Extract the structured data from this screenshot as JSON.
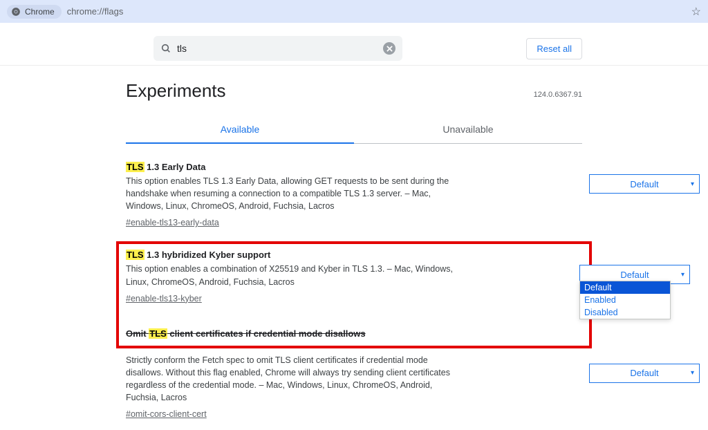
{
  "omnibox": {
    "chip": "Chrome",
    "url": "chrome://flags"
  },
  "search": {
    "value": "tls",
    "reset": "Reset all"
  },
  "header": {
    "title": "Experiments",
    "version": "124.0.6367.91"
  },
  "tabs": {
    "available": "Available",
    "unavailable": "Unavailable"
  },
  "flags": [
    {
      "title_prefix": "TLS",
      "title_rest": " 1.3 Early Data",
      "desc": "This option enables TLS 1.3 Early Data, allowing GET requests to be sent during the handshake when resuming a connection to a compatible TLS 1.3 server. – Mac, Windows, Linux, ChromeOS, Android, Fuchsia, Lacros",
      "anchor": "#enable-tls13-early-data",
      "select": "Default"
    },
    {
      "title_prefix": "TLS",
      "title_rest": " 1.3 hybridized Kyber support",
      "desc": "This option enables a combination of X25519 and Kyber in TLS 1.3. – Mac, Windows, Linux, ChromeOS, Android, Fuchsia, Lacros",
      "anchor": "#enable-tls13-kyber",
      "select": "Default",
      "options": [
        "Default",
        "Enabled",
        "Disabled"
      ]
    },
    {
      "title_struck_pre": "Omit ",
      "title_struck_mark": "TLS",
      "title_struck_post": " client certificates if credential mode disallows",
      "desc": "Strictly conform the Fetch spec to omit TLS client certificates if credential mode disallows. Without this flag enabled, Chrome will always try sending client certificates regardless of the credential mode. – Mac, Windows, Linux, ChromeOS, Android, Fuchsia, Lacros",
      "anchor": "#omit-cors-client-cert",
      "select": "Default"
    }
  ]
}
